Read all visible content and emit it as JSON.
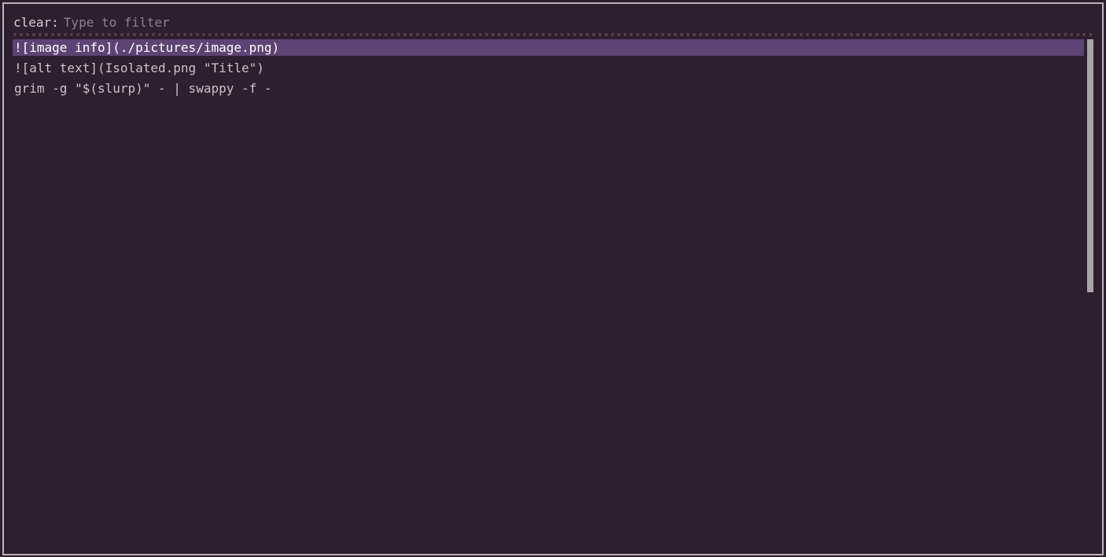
{
  "picker": {
    "prompt_label": "clear:",
    "filter_value": "",
    "filter_placeholder": "Type to filter",
    "items": [
      {
        "label": "![image info](./pictures/image.png)",
        "selected": true
      },
      {
        "label": "![alt text](Isolated.png \"Title\")",
        "selected": false
      },
      {
        "label": "grim -g \"$(slurp)\" - | swappy -f -",
        "selected": false
      }
    ]
  },
  "colors": {
    "background": "#2e1f2f",
    "border": "#b9b4b9",
    "selection": "#5e4474",
    "text": "#c9c3c9",
    "placeholder": "#8c838c",
    "scrollbar": "#a9a5a9",
    "separator": "#5a3b4e"
  }
}
